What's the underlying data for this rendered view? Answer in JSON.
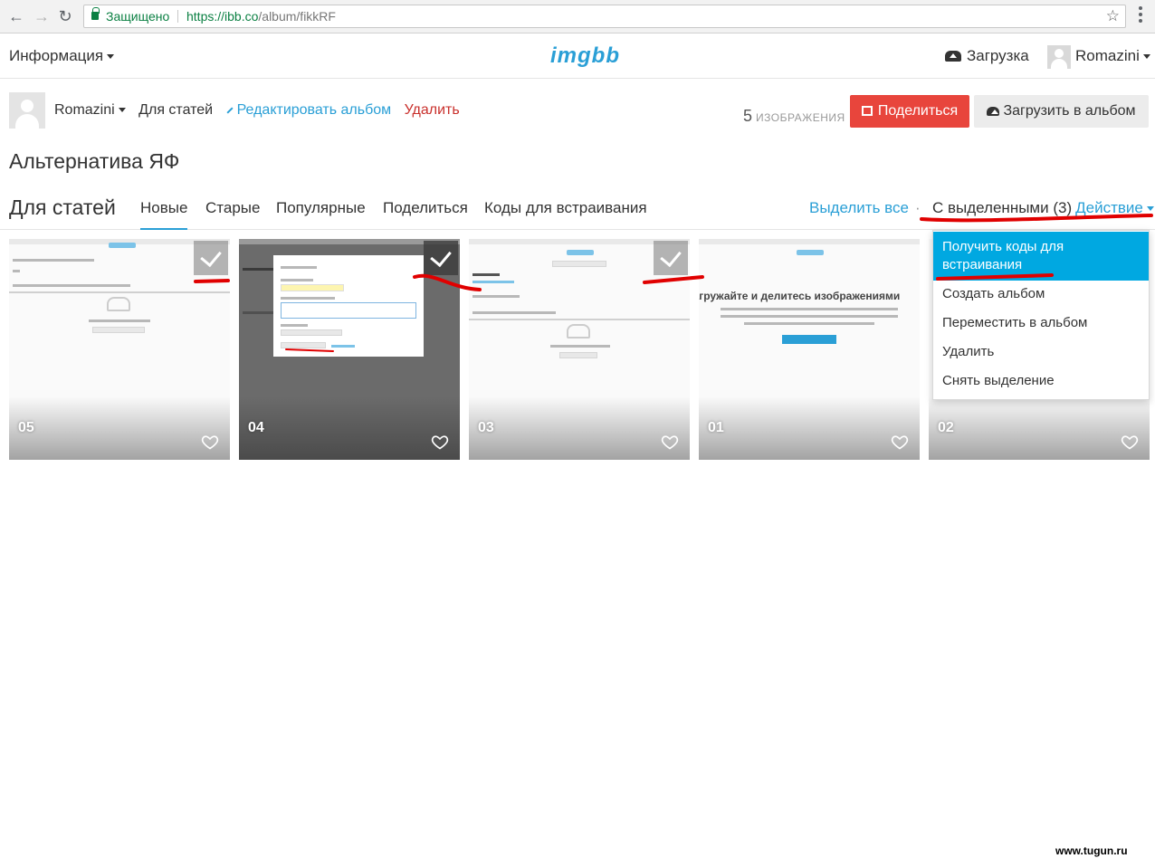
{
  "browser": {
    "secure_label": "Защищено",
    "url_host": "https://ibb.co",
    "url_path": "/album/fikkRF"
  },
  "topbar": {
    "info_menu": "Информация",
    "logo": "imgbb",
    "upload": "Загрузка",
    "user": "Romazini"
  },
  "album_meta": {
    "owner": "Romazini",
    "album_name": "Для статей",
    "edit": "Редактировать альбом",
    "delete": "Удалить",
    "count": "5",
    "count_label": "ИЗОБРАЖЕНИЯ",
    "share_button": "Поделиться",
    "upload_button": "Загрузить в альбом"
  },
  "album_description": "Альтернатива ЯФ",
  "tabs": {
    "title": "Для статей",
    "items": [
      "Новые",
      "Старые",
      "Популярные",
      "Поделиться",
      "Коды для встраивания"
    ],
    "active": 0,
    "select_all": "Выделить все",
    "separator": "·",
    "with_selected": "С выделенными (3)",
    "action": "Действие"
  },
  "thumbnails": [
    {
      "label": "05",
      "selected": true
    },
    {
      "label": "04",
      "selected": true
    },
    {
      "label": "03",
      "selected": true
    },
    {
      "label": "01",
      "selected": false,
      "headline": "Загружайте и делитесь изображениями"
    },
    {
      "label": "02",
      "selected": false
    }
  ],
  "dropdown": {
    "items": [
      "Получить коды для встраивания",
      "Создать альбом",
      "Переместить в альбом",
      "Удалить",
      "Снять выделение"
    ],
    "highlighted": 0,
    "highlight_color": "#00a8e1"
  },
  "colors": {
    "accent": "#2a9fd6",
    "share": "#e8453c",
    "delete": "#c9302c",
    "annotation": "#e00000"
  },
  "watermark": "www.tugun.ru"
}
